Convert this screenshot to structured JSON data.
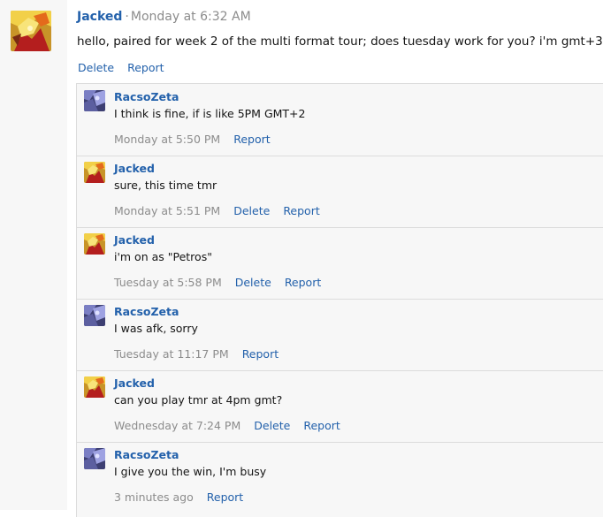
{
  "main_post": {
    "author": "Jacked",
    "separator": "·",
    "time": "Monday at 6:32 AM",
    "text": "hello, paired for week 2 of the multi format tour; does tuesday work for you? i'm gmt+3",
    "delete_label": "Delete",
    "report_label": "Report"
  },
  "replies": [
    {
      "author": "RacsoZeta",
      "text": "I think is fine, if is like 5PM GMT+2",
      "time": "Monday at 5:50 PM",
      "report_label": "Report"
    },
    {
      "author": "Jacked",
      "text": "sure, this time tmr",
      "time": "Monday at 5:51 PM",
      "delete_label": "Delete",
      "report_label": "Report"
    },
    {
      "author": "Jacked",
      "text": "i'm on as \"Petros\"",
      "time": "Tuesday at 5:58 PM",
      "delete_label": "Delete",
      "report_label": "Report"
    },
    {
      "author": "RacsoZeta",
      "text": "I was afk, sorry",
      "time": "Tuesday at 11:17 PM",
      "report_label": "Report"
    },
    {
      "author": "Jacked",
      "text": "can you play tmr at 4pm gmt?",
      "time": "Wednesday at 7:24 PM",
      "delete_label": "Delete",
      "report_label": "Report"
    },
    {
      "author": "RacsoZeta",
      "text": "I give you the win, I'm busy",
      "time": "3 minutes ago",
      "report_label": "Report"
    }
  ],
  "colors": {
    "link": "#2361ab",
    "muted": "#8c8c8c",
    "reply_background": "#f7f7f7",
    "border": "#dcdcdc"
  },
  "icons": {
    "jacked_avatar": "anime-character-avatar-icon",
    "racsozeta_avatar": "abstract-purple-avatar-icon"
  }
}
